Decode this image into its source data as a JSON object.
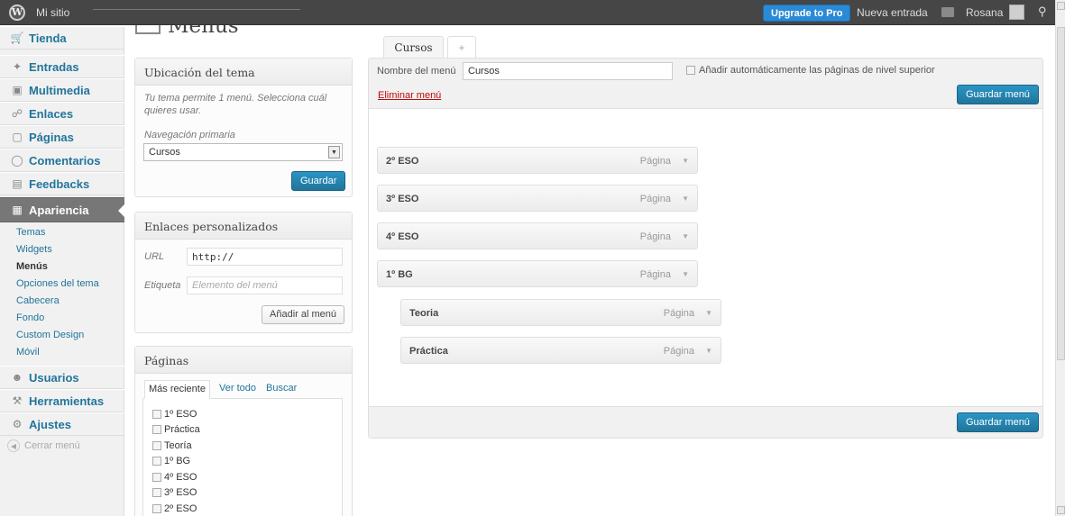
{
  "adminbar": {
    "site_name": "Mi sitio",
    "upgrade": "Upgrade to Pro",
    "new_post": "Nueva entrada",
    "user": "Rosana"
  },
  "sidebar": {
    "items": [
      {
        "label": "Tienda",
        "icon": "cart-icon"
      },
      {
        "label": "Entradas",
        "icon": "pin-icon"
      },
      {
        "label": "Multimedia",
        "icon": "media-icon"
      },
      {
        "label": "Enlaces",
        "icon": "link-icon"
      },
      {
        "label": "Páginas",
        "icon": "pages-icon"
      },
      {
        "label": "Comentarios",
        "icon": "comment-icon"
      },
      {
        "label": "Feedbacks",
        "icon": "feedback-icon"
      },
      {
        "label": "Apariencia",
        "icon": "appearance-icon"
      }
    ],
    "submenu": [
      "Temas",
      "Widgets",
      "Menús",
      "Opciones del tema",
      "Cabecera",
      "Fondo",
      "Custom Design",
      "Móvil"
    ],
    "items_bottom": [
      {
        "label": "Usuarios",
        "icon": "users-icon"
      },
      {
        "label": "Herramientas",
        "icon": "tools-icon"
      },
      {
        "label": "Ajustes",
        "icon": "settings-icon"
      }
    ],
    "collapse": "Cerrar menú"
  },
  "page": {
    "title": "Menus"
  },
  "theme_location": {
    "title": "Ubicación del tema",
    "description": "Tu tema permite 1 menú. Selecciona cuál quieres usar.",
    "nav_label": "Navegación primaria",
    "selected": "Cursos",
    "save": "Guardar"
  },
  "custom_links": {
    "title": "Enlaces personalizados",
    "url_label": "URL",
    "url_value": "http://",
    "label_label": "Etiqueta",
    "label_placeholder": "Elemento del menú",
    "add": "Añadir al menú"
  },
  "pages_box": {
    "title": "Páginas",
    "tabs": [
      "Más reciente",
      "Ver todo",
      "Buscar"
    ],
    "items": [
      "1º ESO",
      "Práctica",
      "Teoría",
      "1º BG",
      "4º ESO",
      "3º ESO",
      "2º ESO"
    ]
  },
  "menu_editor": {
    "tab": "Cursos",
    "add_tab": "+",
    "name_label": "Nombre del menú",
    "name_value": "Cursos",
    "auto_add": "Añadir automáticamente las páginas de nivel superior",
    "delete": "Eliminar menú",
    "save": "Guardar menú",
    "items": [
      {
        "title": "2º ESO",
        "type": "Página",
        "depth": 0
      },
      {
        "title": "3º ESO",
        "type": "Página",
        "depth": 0
      },
      {
        "title": "4º ESO",
        "type": "Página",
        "depth": 0
      },
      {
        "title": "1º BG",
        "type": "Página",
        "depth": 0
      },
      {
        "title": "Teoria",
        "type": "Página",
        "depth": 1
      },
      {
        "title": "Práctica",
        "type": "Página",
        "depth": 1
      }
    ]
  }
}
